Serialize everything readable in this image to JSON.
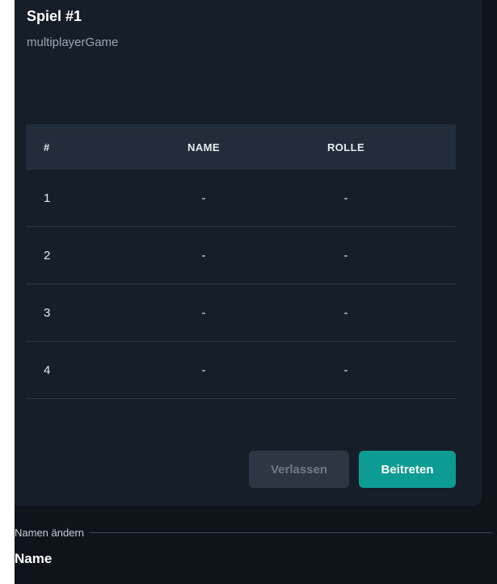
{
  "game": {
    "title": "Spiel #1",
    "subtitle": "multiplayerGame"
  },
  "table": {
    "headers": [
      "#",
      "NAME",
      "ROLLE"
    ],
    "rows": [
      {
        "num": "1",
        "name": "-",
        "role": "-"
      },
      {
        "num": "2",
        "name": "-",
        "role": "-"
      },
      {
        "num": "3",
        "name": "-",
        "role": "-"
      },
      {
        "num": "4",
        "name": "-",
        "role": "-"
      }
    ]
  },
  "actions": {
    "leave_label": "Verlassen",
    "join_label": "Beitreten"
  },
  "rename_section": {
    "divider_label": "Namen ändern",
    "field_label": "Name"
  },
  "colors": {
    "accent": "#0d9c93",
    "card": "#161e28",
    "background": "#0f141b"
  }
}
